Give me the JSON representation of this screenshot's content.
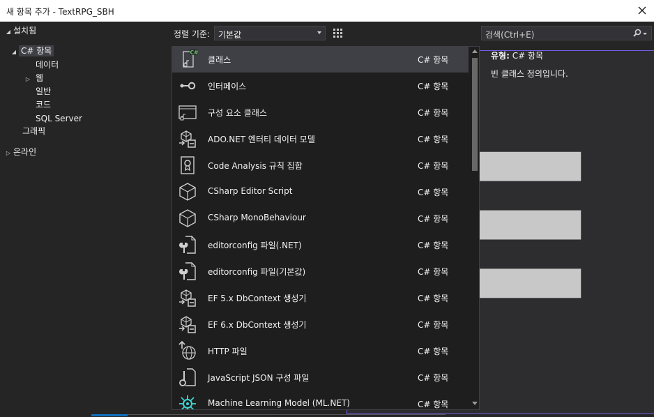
{
  "window": {
    "title": "새 항목 추가 - TextRPG_SBH"
  },
  "tree": {
    "installed": "설치됨",
    "csharp": "C# 항목",
    "data": "데이터",
    "web": "웹",
    "general": "일반",
    "code": "코드",
    "sqlserver": "SQL Server",
    "graphics": "그래픽",
    "online": "온라인"
  },
  "toolbar": {
    "sort_label": "정렬 기준:",
    "sort_value": "기본값"
  },
  "search": {
    "placeholder": "검색(Ctrl+E)"
  },
  "items": [
    {
      "name": "클래스",
      "kind": "C# 항목",
      "icon": "class-icon"
    },
    {
      "name": "인터페이스",
      "kind": "C# 항목",
      "icon": "interface-icon"
    },
    {
      "name": "구성 요소 클래스",
      "kind": "C# 항목",
      "icon": "component-class-icon"
    },
    {
      "name": "ADO.NET 엔터티 데이터 모델",
      "kind": "C# 항목",
      "icon": "entity-model-icon"
    },
    {
      "name": "Code Analysis 규칙 집합",
      "kind": "C# 항목",
      "icon": "rule-set-icon"
    },
    {
      "name": "CSharp Editor Script",
      "kind": "C# 항목",
      "icon": "cube-icon"
    },
    {
      "name": "CSharp MonoBehaviour",
      "kind": "C# 항목",
      "icon": "cube-icon"
    },
    {
      "name": "editorconfig 파일(.NET)",
      "kind": "C# 항목",
      "icon": "wrench-file-icon"
    },
    {
      "name": "editorconfig 파일(기본값)",
      "kind": "C# 항목",
      "icon": "wrench-file-icon"
    },
    {
      "name": "EF 5.x DbContext 생성기",
      "kind": "C# 항목",
      "icon": "entity-model-icon"
    },
    {
      "name": "EF 6.x DbContext 생성기",
      "kind": "C# 항목",
      "icon": "entity-model-icon"
    },
    {
      "name": "HTTP 파일",
      "kind": "C# 항목",
      "icon": "http-file-icon"
    },
    {
      "name": "JavaScript JSON 구성 파일",
      "kind": "C# 항목",
      "icon": "json-config-icon"
    },
    {
      "name": "Machine Learning Model (ML.NET)",
      "kind": "C# 항목",
      "icon": "ml-model-icon"
    }
  ],
  "details": {
    "type_label": "유형:",
    "type_value": "C# 항목",
    "description": "빈 클래스 정의입니다."
  }
}
